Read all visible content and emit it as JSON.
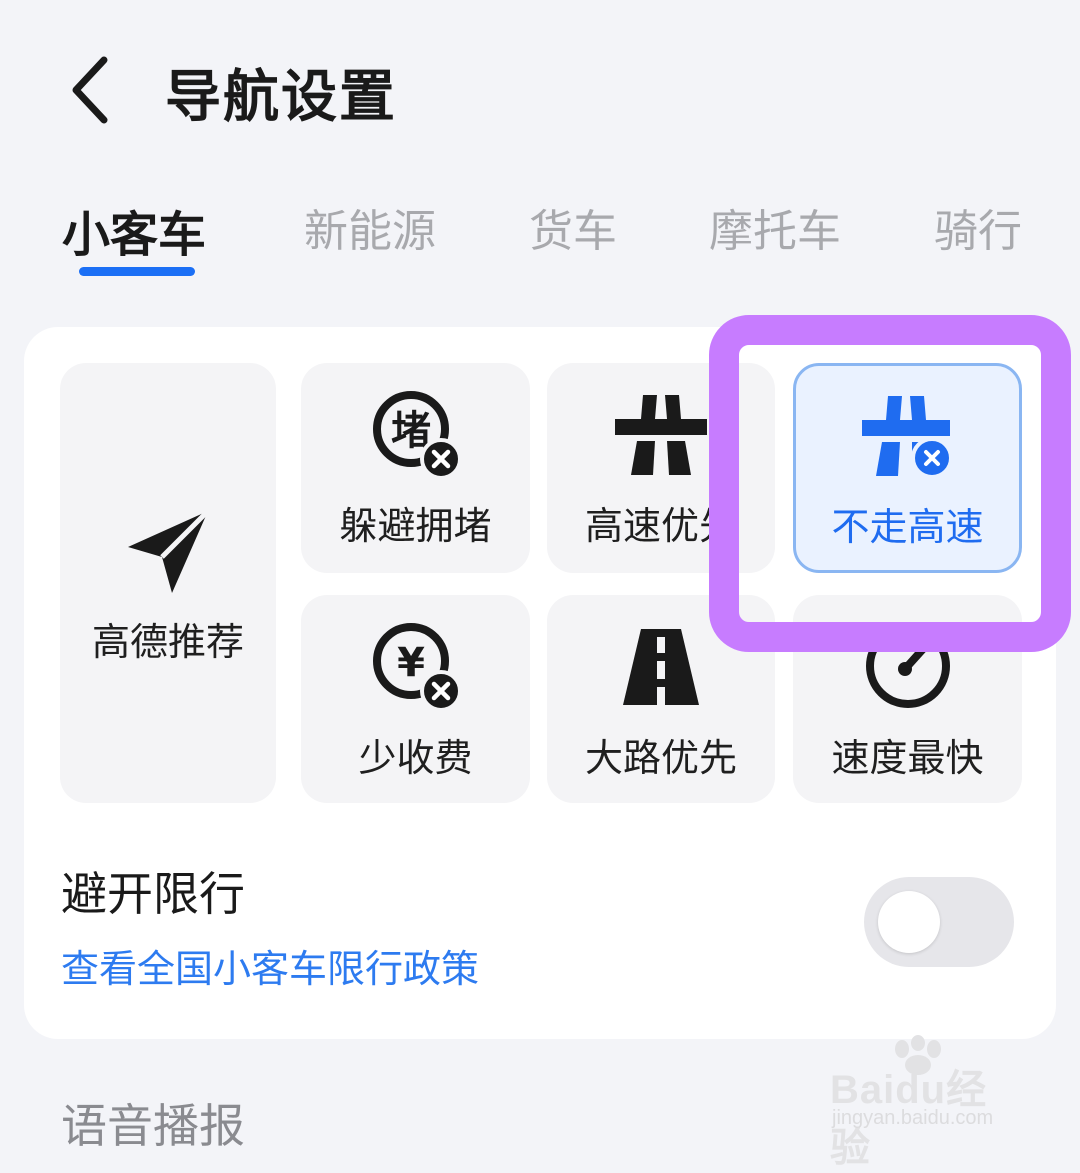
{
  "header": {
    "title": "导航设置",
    "back_icon": "chevron-left-icon"
  },
  "tabs": [
    {
      "label": "小客车",
      "active": true
    },
    {
      "label": "新能源",
      "active": false
    },
    {
      "label": "货车",
      "active": false
    },
    {
      "label": "摩托车",
      "active": false
    },
    {
      "label": "骑行",
      "active": false
    }
  ],
  "route_options": [
    {
      "label": "高德推荐",
      "icon": "paper-plane-icon",
      "selected": false
    },
    {
      "label": "躲避拥堵",
      "icon": "avoid-congestion-icon",
      "selected": false
    },
    {
      "label": "高速优先",
      "icon": "highway-icon",
      "selected": false
    },
    {
      "label": "不走高速",
      "icon": "no-highway-icon",
      "selected": true
    },
    {
      "label": "少收费",
      "icon": "less-toll-icon",
      "selected": false
    },
    {
      "label": "大路优先",
      "icon": "main-road-icon",
      "selected": false
    },
    {
      "label": "速度最快",
      "icon": "speedometer-icon",
      "selected": false
    }
  ],
  "restriction": {
    "title": "避开限行",
    "link": "查看全国小客车限行政策",
    "toggle_on": false
  },
  "next_section": {
    "title": "语音播报"
  },
  "colors": {
    "accent": "#1b6ff5",
    "highlight": "#c77cff",
    "link": "#2d7bf0"
  },
  "watermark": {
    "brand": "Baidu经验",
    "url": "jingyan.baidu.com"
  }
}
